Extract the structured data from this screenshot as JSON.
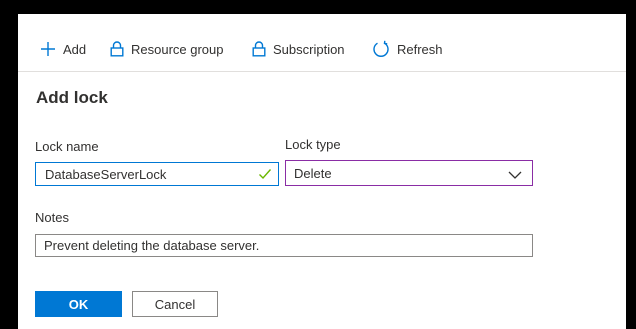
{
  "toolbar": {
    "add_label": "Add",
    "resource_group_label": "Resource group",
    "subscription_label": "Subscription",
    "refresh_label": "Refresh"
  },
  "title": "Add lock",
  "form": {
    "lock_name_label": "Lock name",
    "lock_name_value": "DatabaseServerLock",
    "lock_type_label": "Lock type",
    "lock_type_value": "Delete",
    "notes_label": "Notes",
    "notes_value": "Prevent deleting the database server."
  },
  "buttons": {
    "ok_label": "OK",
    "cancel_label": "Cancel"
  },
  "colors": {
    "accent": "#0078d4",
    "focus_border": "#8a2da5",
    "valid_check": "#6bb700"
  },
  "icons": {
    "add": "plus-icon",
    "resource_group": "lock-icon",
    "subscription": "lock-icon",
    "refresh": "refresh-icon",
    "valid": "checkmark-icon",
    "dropdown": "chevron-down-icon"
  }
}
